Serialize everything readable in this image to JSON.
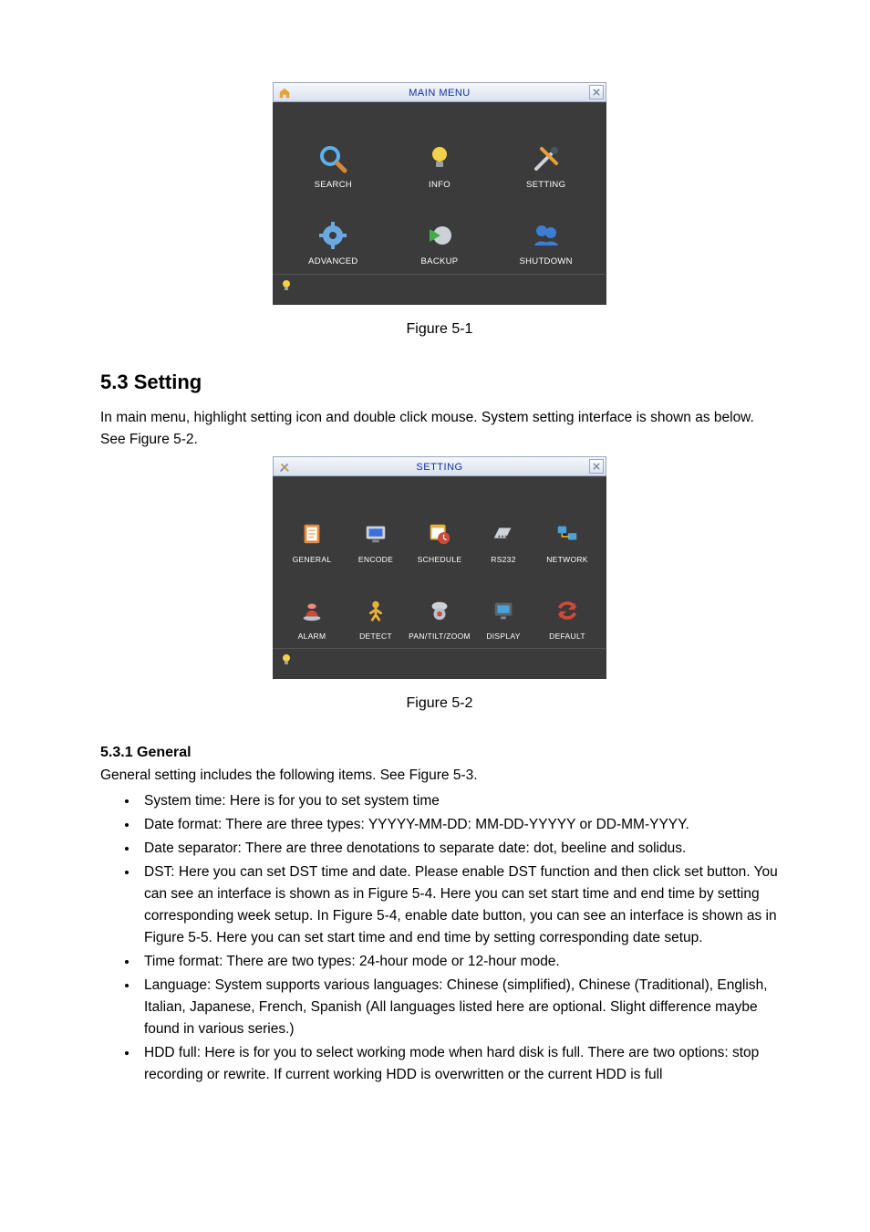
{
  "figure1": {
    "caption": "Figure 5-1",
    "window_title": "MAIN MENU",
    "items": [
      {
        "name": "search-item",
        "label": "SEARCH"
      },
      {
        "name": "info-item",
        "label": "INFO"
      },
      {
        "name": "setting-item",
        "label": "SETTING"
      },
      {
        "name": "advanced-item",
        "label": "ADVANCED"
      },
      {
        "name": "backup-item",
        "label": "BACKUP"
      },
      {
        "name": "shutdown-item",
        "label": "SHUTDOWN"
      }
    ]
  },
  "section": {
    "number_title": "5.3  Setting",
    "intro": "In main menu, highlight setting icon and double click mouse. System setting interface is shown as below. See Figure 5-2."
  },
  "figure2": {
    "caption": "Figure 5-2",
    "window_title": "SETTING",
    "items": [
      {
        "name": "general-item",
        "label": "GENERAL"
      },
      {
        "name": "encode-item",
        "label": "ENCODE"
      },
      {
        "name": "schedule-item",
        "label": "SCHEDULE"
      },
      {
        "name": "rs232-item",
        "label": "RS232"
      },
      {
        "name": "network-item",
        "label": "NETWORK"
      },
      {
        "name": "alarm-item",
        "label": "ALARM"
      },
      {
        "name": "detect-item",
        "label": "DETECT"
      },
      {
        "name": "ptz-item",
        "label": "PAN/TILT/ZOOM"
      },
      {
        "name": "display-item",
        "label": "DISPLAY"
      },
      {
        "name": "default-item",
        "label": "DEFAULT"
      }
    ]
  },
  "subsection": {
    "number_title": "5.3.1  General",
    "intro": "General setting includes the following items. See Figure 5-3.",
    "bullets": [
      "System time: Here is for you to set system time",
      "Date format: There are three types: YYYYY-MM-DD: MM-DD-YYYYY or DD-MM-YYYY.",
      "Date separator: There are three denotations to separate date: dot, beeline and solidus.",
      "DST: Here you can set DST time and date. Please enable DST function and then click set button. You can see an interface is shown as in Figure 5-4. Here you can set start time and end time by setting corresponding week setup. In Figure 5-4, enable date button, you can see an interface is shown as in Figure 5-5. Here you can set start time and end time by setting corresponding date setup.",
      "Time format: There are two types: 24-hour mode or 12-hour mode.",
      "Language: System supports various languages: Chinese (simplified), Chinese (Traditional), English, Italian, Japanese, French, Spanish (All languages listed here are optional. Slight difference maybe found in various series.)",
      "HDD full: Here is for you to select working mode when hard disk is full. There are two options: stop recording or rewrite. If current working HDD is overwritten or the current HDD is full"
    ]
  }
}
